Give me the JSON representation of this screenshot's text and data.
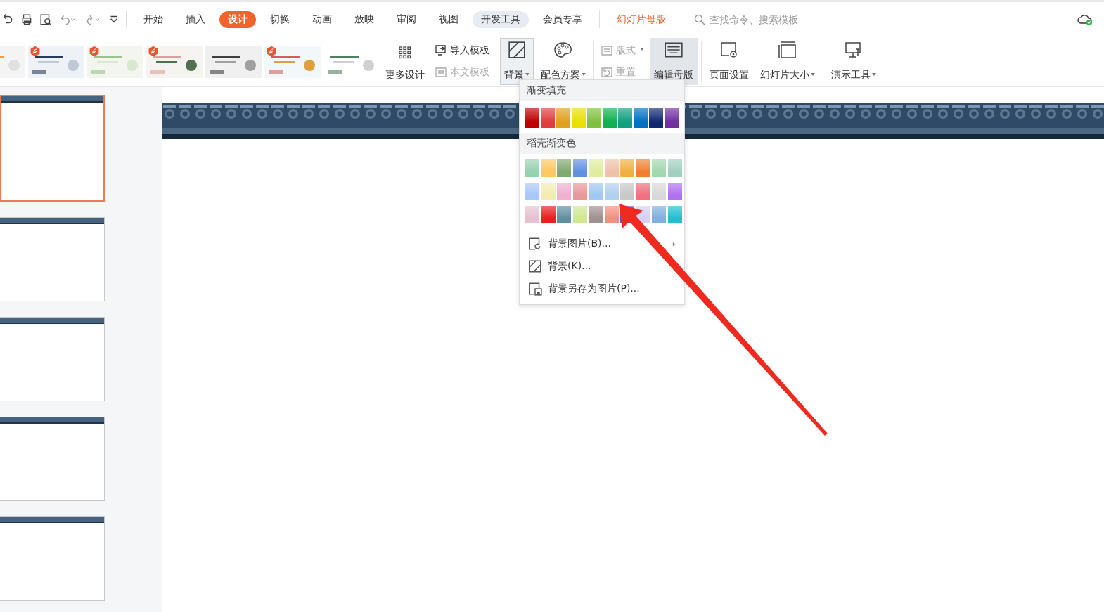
{
  "tabs": [
    {
      "label": "开始",
      "selected": false,
      "kind": "normal"
    },
    {
      "label": "插入",
      "selected": false,
      "kind": "normal"
    },
    {
      "label": "设计",
      "selected": true,
      "kind": "normal"
    },
    {
      "label": "切换",
      "selected": false,
      "kind": "normal"
    },
    {
      "label": "动画",
      "selected": false,
      "kind": "normal"
    },
    {
      "label": "放映",
      "selected": false,
      "kind": "normal"
    },
    {
      "label": "审阅",
      "selected": false,
      "kind": "normal"
    },
    {
      "label": "视图",
      "selected": false,
      "kind": "normal"
    },
    {
      "label": "开发工具",
      "selected": false,
      "kind": "hover"
    },
    {
      "label": "会员专享",
      "selected": false,
      "kind": "normal"
    },
    {
      "label": "幻灯片母版",
      "selected": false,
      "kind": "context"
    }
  ],
  "search": {
    "placeholder": "查找命令、搜索模板"
  },
  "templates": [
    {
      "kind": "picture"
    },
    {
      "kind": "picture",
      "badge": true
    },
    {
      "kind": "picture",
      "badge": true
    },
    {
      "kind": "picture",
      "badge": true
    },
    {
      "kind": "picture"
    },
    {
      "kind": "picture",
      "badge": true
    },
    {
      "kind": "picture"
    }
  ],
  "ribbon": {
    "more_design": "更多设计",
    "import_template": {
      "label": "导入模板",
      "disabled": false
    },
    "text_template": {
      "label": "本文模板",
      "disabled": true
    },
    "background": {
      "label": "背景",
      "selected": true
    },
    "color_scheme": {
      "label": "配色方案"
    },
    "layout": {
      "label": "版式",
      "disabled": true
    },
    "reset": {
      "label": "重置",
      "disabled": true
    },
    "edit_master": {
      "label": "编辑母版",
      "selected": true
    },
    "page_setup": {
      "label": "页面设置"
    },
    "slide_size": {
      "label": "幻灯片大小"
    },
    "present_tools": {
      "label": "演示工具"
    }
  },
  "slides": [
    {
      "selected": true
    },
    {
      "selected": false
    },
    {
      "selected": false
    },
    {
      "selected": false
    },
    {
      "selected": false
    }
  ],
  "dropdown": {
    "gradient_header": "渐变填充",
    "gradient_fills": [
      {
        "color": "#c00000"
      },
      {
        "color": "#e03c3c"
      },
      {
        "color": "#e0a020"
      },
      {
        "color": "#e8e000"
      },
      {
        "color": "#80c040"
      },
      {
        "color": "#10b050"
      },
      {
        "color": "#10a080"
      },
      {
        "color": "#0070c0"
      },
      {
        "color": "#102870"
      },
      {
        "color": "#7030a0"
      }
    ],
    "docer_header": "稻壳渐变色",
    "docer_gradients": [
      {
        "color": "#98d0b0"
      },
      {
        "color": "#ffc860"
      },
      {
        "color": "#80a870"
      },
      {
        "color": "#6090e0"
      },
      {
        "color": "#e0eca0"
      },
      {
        "color": "#f0c0a8"
      },
      {
        "color": "#f0b040"
      },
      {
        "color": "#f08030"
      },
      {
        "color": "#a0d8b0"
      },
      {
        "color": "#a0d0c0"
      },
      {
        "color": "#a8c8f8"
      },
      {
        "color": "#f4ecb0"
      },
      {
        "color": "#f0b0d0"
      },
      {
        "color": "#e89898"
      },
      {
        "color": "#a0c8f0"
      },
      {
        "color": "#b0d0f0"
      },
      {
        "color": "#c8c8c8"
      },
      {
        "color": "#f07080"
      },
      {
        "color": "#d8d8d8"
      },
      {
        "color": "#b070f0"
      },
      {
        "color": "#e8c0d0"
      },
      {
        "color": "#e82020"
      },
      {
        "color": "#6090a0"
      },
      {
        "color": "#d0e890"
      },
      {
        "color": "#a09090"
      },
      {
        "color": "#f09080"
      },
      {
        "color": "#7050c0"
      },
      {
        "color": "#d8d0f8"
      },
      {
        "color": "#80b0e0"
      },
      {
        "color": "#20c0d0"
      }
    ],
    "items": [
      {
        "label": "背景图片(B)...",
        "kind": "picture",
        "submenu": true
      },
      {
        "label": "背景(K)...",
        "kind": "background"
      },
      {
        "label": "背景另存为图片(P)...",
        "kind": "save"
      }
    ]
  }
}
